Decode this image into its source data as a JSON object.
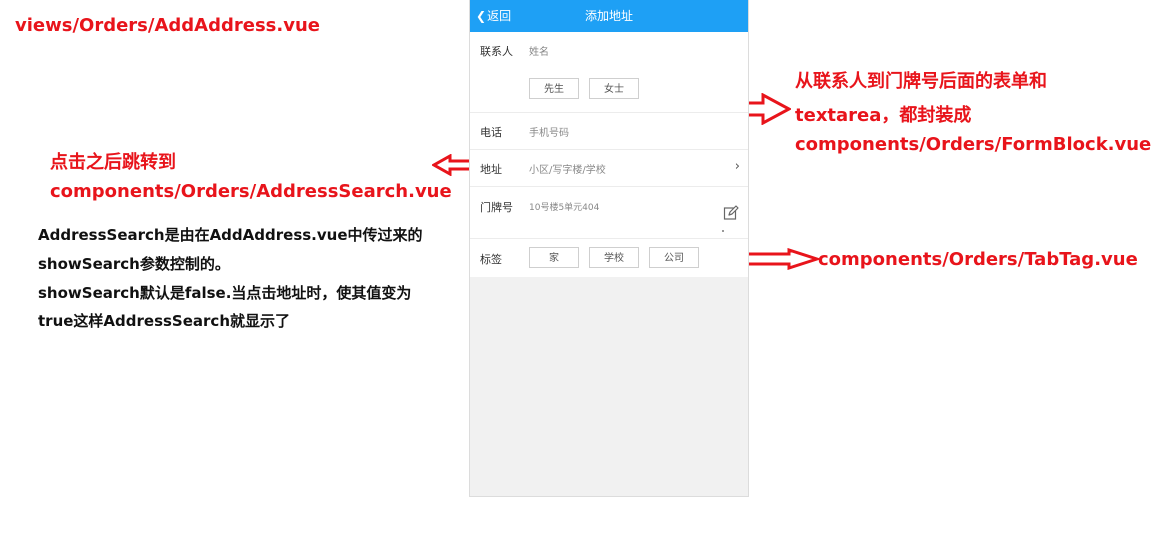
{
  "annotations": {
    "top_left": "views/Orders/AddAddress.vue",
    "left_red_line1": "点击之后跳转到",
    "left_red_line2": "components/Orders/AddressSearch.vue",
    "left_black_line1": "AddressSearch是由在AddAddress.vue中传过来的",
    "left_black_line2": "showSearch参数控制的。",
    "left_black_line3": "showSearch默认是false.当点击地址时，使其值变为",
    "left_black_line4": "true这样AddressSearch就显示了",
    "right_red_line1": "从联系人到门牌号后面的表单和",
    "right_red_line2": "textarea，都封装成",
    "right_red_line3": "components/Orders/FormBlock.vue",
    "right_tag": "components/Orders/TabTag.vue"
  },
  "header": {
    "back_label": "返回",
    "title": "添加地址"
  },
  "form": {
    "contact_label": "联系人",
    "contact_placeholder": "姓名",
    "gender_options": [
      "先生",
      "女士"
    ],
    "phone_label": "电话",
    "phone_placeholder": "手机号码",
    "address_label": "地址",
    "address_placeholder": "小区/写字楼/学校",
    "door_label": "门牌号",
    "door_placeholder": "10号楼5单元404",
    "tag_label": "标签",
    "tag_options": [
      "家",
      "学校",
      "公司"
    ]
  },
  "icons": {
    "back": "chevron-left-icon",
    "address_arrow": "chevron-right-icon",
    "edit": "pencil-edit-icon"
  },
  "colors": {
    "header_bg": "#1ea0f5",
    "annotation_red": "#e8141b"
  }
}
